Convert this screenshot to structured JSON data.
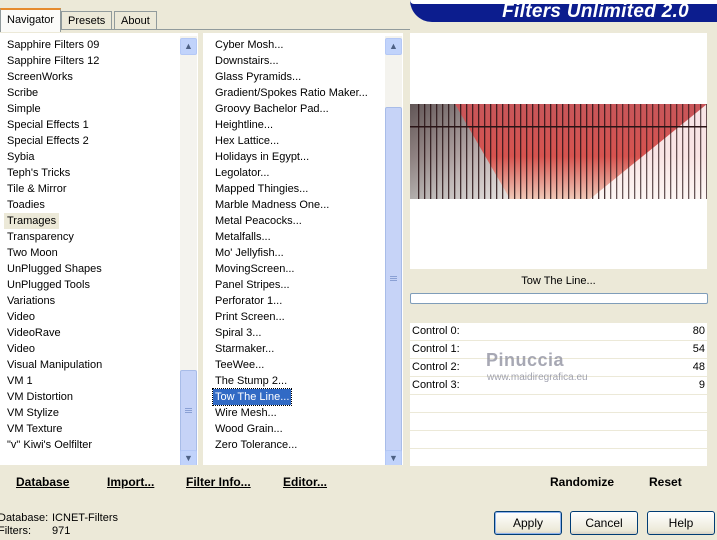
{
  "tabs": [
    "Navigator",
    "Presets",
    "About"
  ],
  "banner": "Filters Unlimited 2.0",
  "categories": [
    "Sapphire Filters 09",
    "Sapphire Filters 12",
    "ScreenWorks",
    "Scribe",
    "Simple",
    "Special Effects 1",
    "Special Effects 2",
    "Sybia",
    "Teph's Tricks",
    "Tile & Mirror",
    "Toadies",
    "Tramages",
    "Transparency",
    "Two Moon",
    "UnPlugged Shapes",
    "UnPlugged Tools",
    "Variations",
    "Video",
    "VideoRave",
    "Video",
    "Visual Manipulation",
    "VM 1",
    "VM Distortion",
    "VM Stylize",
    "VM Texture",
    "\"v\" Kiwi's Oelfilter"
  ],
  "selected_category": "Tramages",
  "filters": [
    "Cyber Mosh...",
    "Downstairs...",
    "Glass Pyramids...",
    "Gradient/Spokes Ratio Maker...",
    "Groovy Bachelor Pad...",
    "Heightline...",
    "Hex Lattice...",
    "Holidays in Egypt...",
    "Legolator...",
    "Mapped Thingies...",
    "Marble Madness One...",
    "Metal Peacocks...",
    "Metalfalls...",
    "Mo' Jellyfish...",
    "MovingScreen...",
    "Panel Stripes...",
    "Perforator 1...",
    "Print Screen...",
    "Spiral 3...",
    "Starmaker...",
    "TeeWee...",
    "The Stump 2...",
    "Tow The Line...",
    "Wire Mesh...",
    "Wood Grain...",
    "Zero Tolerance..."
  ],
  "selected_filter": "Tow The Line...",
  "filter_title": "Tow The Line...",
  "controls": [
    {
      "label": "Control 0:",
      "value": "80"
    },
    {
      "label": "Control 1:",
      "value": "54"
    },
    {
      "label": "Control 2:",
      "value": "48"
    },
    {
      "label": "Control 3:",
      "value": "9"
    }
  ],
  "watermark": {
    "name": "Pinuccia",
    "url": "www.maidiregrafica.eu"
  },
  "bottom_links": {
    "database": "Database",
    "import": "Import...",
    "filter_info": "Filter Info...",
    "editor": "Editor...",
    "randomize": "Randomize",
    "reset": "Reset"
  },
  "info": {
    "database_label": "Database:",
    "database_value": "ICNET-Filters",
    "filters_label": "Filters:",
    "filters_value": "971"
  },
  "buttons": {
    "apply": "Apply",
    "cancel": "Cancel",
    "help": "Help"
  },
  "colors": {
    "accent": "#316ac5",
    "banner": "#0c1d8e",
    "preview_red": "#c8565a"
  }
}
